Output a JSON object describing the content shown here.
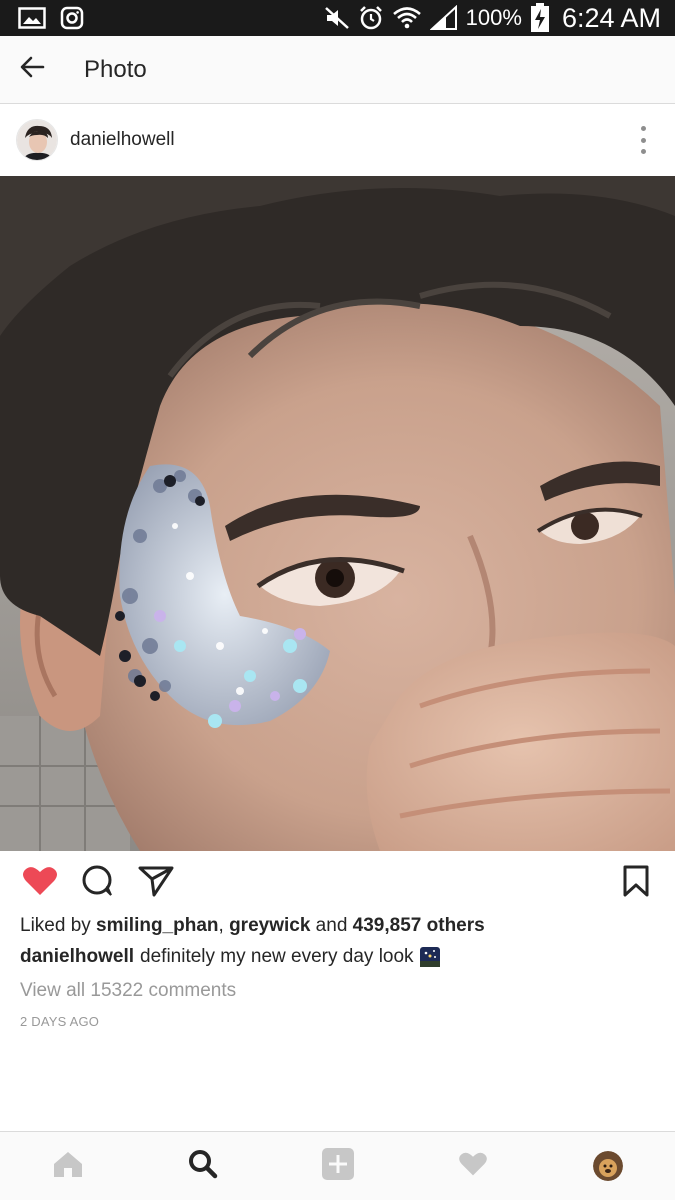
{
  "status_bar": {
    "battery": "100%",
    "time": "6:24 AM",
    "icons": [
      "image-icon",
      "instagram-icon",
      "mute-icon",
      "alarm-icon",
      "wifi-icon",
      "signal-icon",
      "battery-charging-icon"
    ]
  },
  "header": {
    "back_icon": "arrow-left-icon",
    "title": "Photo"
  },
  "post": {
    "username": "danielhowell",
    "more_icon": "more-vertical-icon",
    "likes": {
      "prefix": "Liked by ",
      "user1": "smiling_phan",
      "sep": ", ",
      "user2": "greywick",
      "and": " and ",
      "others": "439,857 others"
    },
    "caption": {
      "username": "danielhowell",
      "text": "definitely my new every day look"
    },
    "comments_link": "View all 15322 comments",
    "timestamp": "2 DAYS AGO",
    "liked": true
  },
  "actions": {
    "like_icon": "heart-filled-icon",
    "comment_icon": "comment-icon",
    "share_icon": "share-icon",
    "bookmark_icon": "bookmark-icon"
  },
  "bottom_nav": {
    "items": [
      "home-icon",
      "search-icon",
      "add-post-icon",
      "activity-heart-icon",
      "profile-avatar"
    ],
    "active": "search-icon"
  },
  "colors": {
    "like_red": "#ed4956",
    "text_primary": "#262626",
    "text_secondary": "#999999",
    "nav_inactive": "#c7c7c7"
  }
}
